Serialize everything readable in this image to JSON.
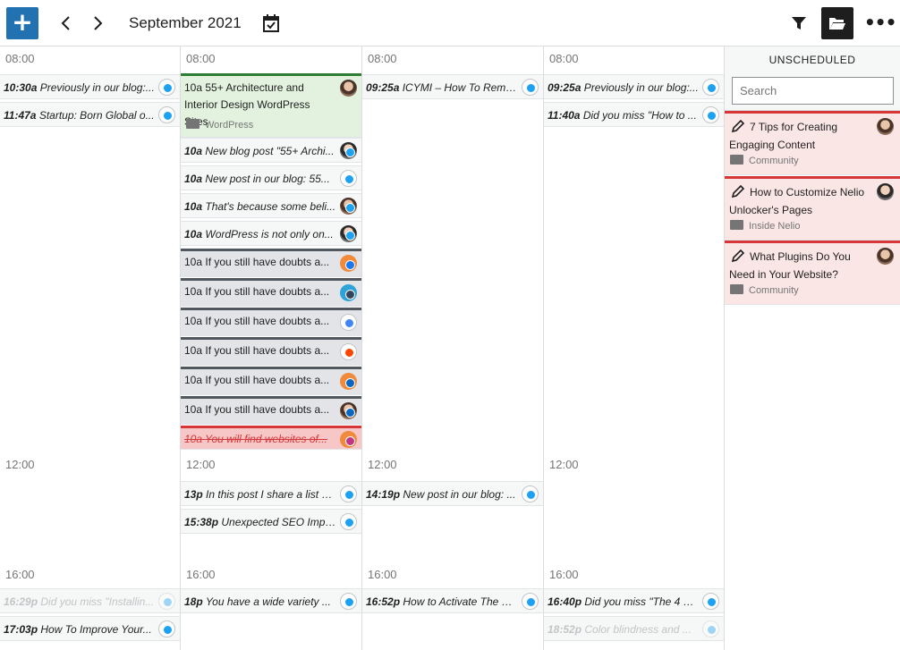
{
  "toolbar": {
    "add_label": "+",
    "prev_label": "‹",
    "next_label": "›",
    "month": "September 2021",
    "more_label": "•••"
  },
  "hours": {
    "h08": "08:00",
    "h12": "12:00",
    "h16": "16:00"
  },
  "columns": [
    {
      "items": [
        {
          "time": "10:30a",
          "text": "Previously in our blog:..."
        },
        {
          "time": "11:47a",
          "text": "Startup: Born Global o..."
        },
        {
          "time": "16:29p",
          "text": "Did you miss \"Installin..."
        },
        {
          "time": "17:03p",
          "text": "How To Improve Your..."
        }
      ]
    },
    {
      "post": {
        "time": "10a",
        "title": "55+ Architecture and Interior Design WordPress Sites",
        "folder": "WordPress"
      },
      "items": [
        {
          "time": "10a",
          "text": "New blog post \"55+ Archi..."
        },
        {
          "time": "10a",
          "text": "New post in our blog: 55..."
        },
        {
          "time": "10a",
          "text": "That's because some beli..."
        },
        {
          "time": "10a",
          "text": "WordPress is not only on..."
        },
        {
          "time": "10a",
          "text": "If you still have doubts a..."
        },
        {
          "time": "10a",
          "text": "If you still have doubts a..."
        },
        {
          "time": "10a",
          "text": "If you still have doubts a..."
        },
        {
          "time": "10a",
          "text": "If you still have doubts a..."
        },
        {
          "time": "10a",
          "text": "If you still have doubts a..."
        },
        {
          "time": "10a",
          "text": "If you still have doubts a..."
        },
        {
          "time": "10a",
          "text": "You will find websites of..."
        },
        {
          "time": "13p",
          "text": "In this post I share a list o..."
        },
        {
          "time": "15:38p",
          "text": "Unexpected SEO Impli..."
        },
        {
          "time": "18p",
          "text": "You have a wide variety ..."
        }
      ]
    },
    {
      "items": [
        {
          "time": "09:25a",
          "text": "ICYMI – How To Remo..."
        },
        {
          "time": "14:19p",
          "text": "New post in our blog: ..."
        },
        {
          "time": "16:52p",
          "text": "How to Activate The N..."
        }
      ]
    },
    {
      "items": [
        {
          "time": "09:25a",
          "text": "Previously in our blog:..."
        },
        {
          "time": "11:40a",
          "text": "Did you miss \"How to ..."
        },
        {
          "time": "16:40p",
          "text": "Did you miss \"The 4 Pi..."
        },
        {
          "time": "18:52p",
          "text": "Color blindness and ..."
        }
      ]
    }
  ],
  "sidebar": {
    "title": "UNSCHEDULED",
    "search_placeholder": "Search",
    "cards": [
      {
        "title": "7 Tips for Creating Engaging Content",
        "folder": "Community"
      },
      {
        "title": "How to Customize Nelio Unlocker's Pages",
        "folder": "Inside Nelio"
      },
      {
        "title": "What Plugins Do You Need in Your Website?",
        "folder": "Community"
      }
    ]
  },
  "colors": {
    "accent": "#2271b1",
    "published_green": "#2e7d32",
    "error_red": "#d63638",
    "pending_dark": "#50575e"
  }
}
